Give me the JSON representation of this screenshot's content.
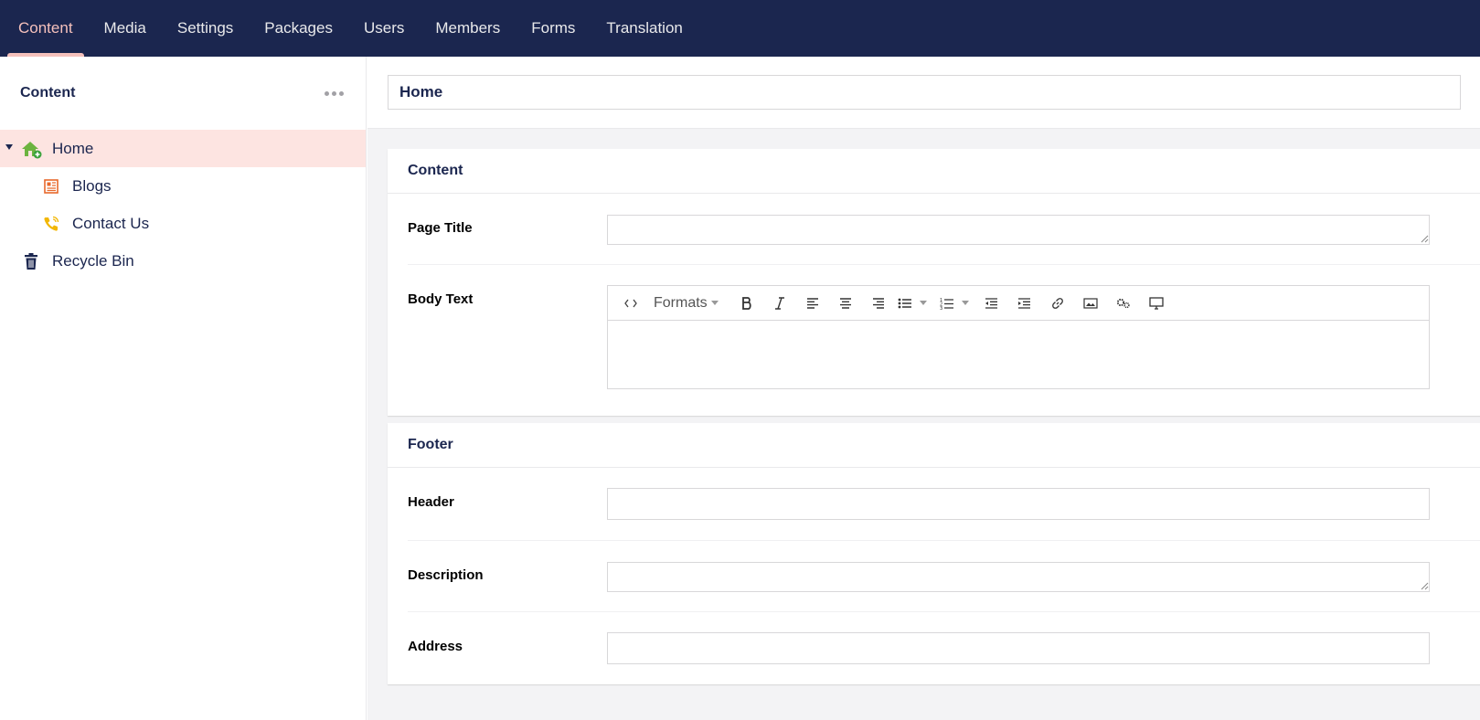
{
  "nav": {
    "items": [
      {
        "label": "Content",
        "active": true
      },
      {
        "label": "Media",
        "active": false
      },
      {
        "label": "Settings",
        "active": false
      },
      {
        "label": "Packages",
        "active": false
      },
      {
        "label": "Users",
        "active": false
      },
      {
        "label": "Members",
        "active": false
      },
      {
        "label": "Forms",
        "active": false
      },
      {
        "label": "Translation",
        "active": false
      }
    ]
  },
  "sidebar": {
    "title": "Content",
    "tree": [
      {
        "label": "Home",
        "icon": "home-icon",
        "selected": true
      },
      {
        "label": "Blogs",
        "icon": "newspaper-icon"
      },
      {
        "label": "Contact Us",
        "icon": "phone-icon"
      },
      {
        "label": "Recycle Bin",
        "icon": "trash-icon"
      }
    ]
  },
  "editor": {
    "node_name": "Home",
    "groups": [
      {
        "title": "Content",
        "properties": [
          {
            "label": "Page Title",
            "value": ""
          },
          {
            "label": "Body Text",
            "value": ""
          }
        ]
      },
      {
        "title": "Footer",
        "properties": [
          {
            "label": "Header",
            "value": ""
          },
          {
            "label": "Description",
            "value": ""
          },
          {
            "label": "Address",
            "value": ""
          }
        ]
      }
    ],
    "rte": {
      "formats_label": "Formats"
    }
  },
  "colors": {
    "nav_bg": "#1b264f",
    "nav_active": "#f5c1bc",
    "selected_bg": "#fde4e1",
    "main_bg": "#f3f3f5"
  }
}
